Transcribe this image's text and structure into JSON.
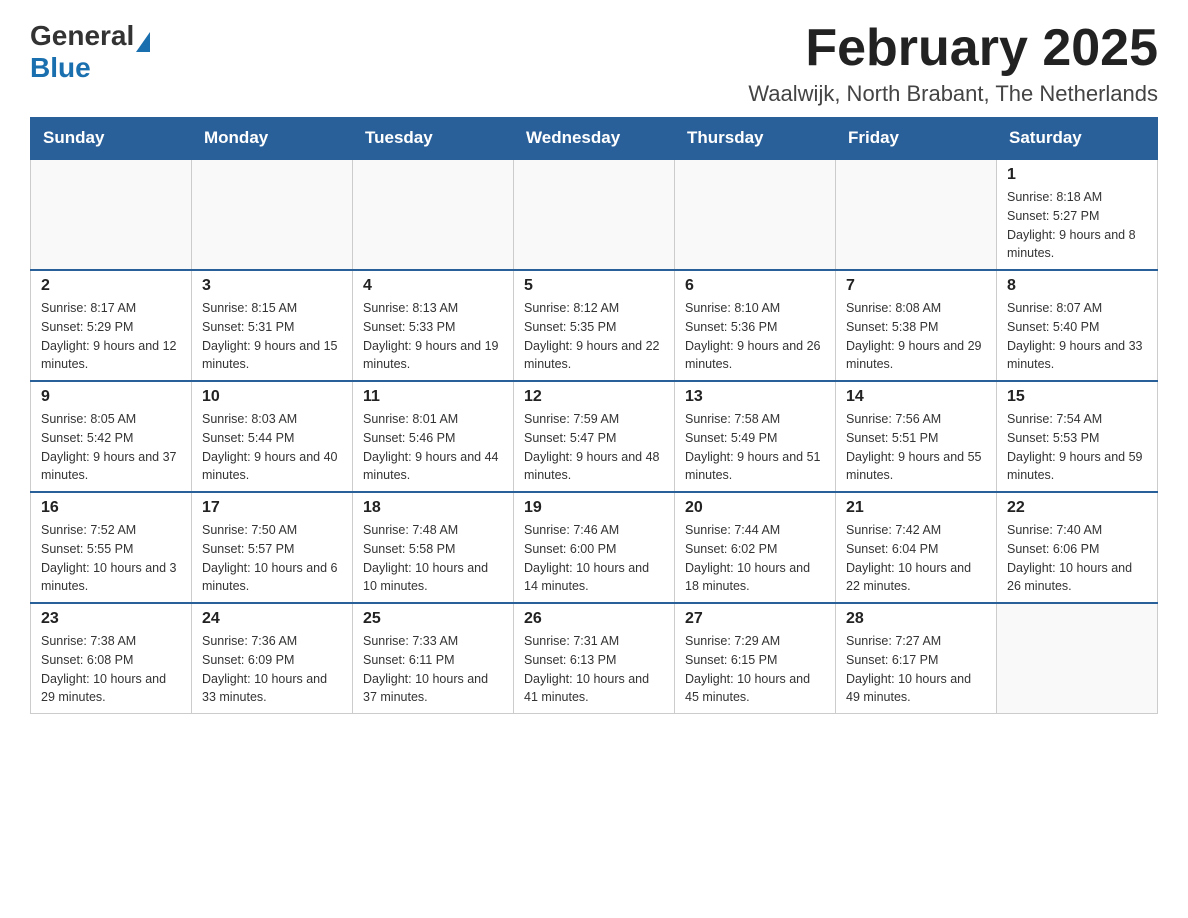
{
  "header": {
    "logo_general": "General",
    "logo_blue": "Blue",
    "title": "February 2025",
    "location": "Waalwijk, North Brabant, The Netherlands"
  },
  "days_of_week": [
    "Sunday",
    "Monday",
    "Tuesday",
    "Wednesday",
    "Thursday",
    "Friday",
    "Saturday"
  ],
  "weeks": [
    {
      "days": [
        {
          "number": "",
          "info": ""
        },
        {
          "number": "",
          "info": ""
        },
        {
          "number": "",
          "info": ""
        },
        {
          "number": "",
          "info": ""
        },
        {
          "number": "",
          "info": ""
        },
        {
          "number": "",
          "info": ""
        },
        {
          "number": "1",
          "info": "Sunrise: 8:18 AM\nSunset: 5:27 PM\nDaylight: 9 hours and 8 minutes."
        }
      ]
    },
    {
      "days": [
        {
          "number": "2",
          "info": "Sunrise: 8:17 AM\nSunset: 5:29 PM\nDaylight: 9 hours and 12 minutes."
        },
        {
          "number": "3",
          "info": "Sunrise: 8:15 AM\nSunset: 5:31 PM\nDaylight: 9 hours and 15 minutes."
        },
        {
          "number": "4",
          "info": "Sunrise: 8:13 AM\nSunset: 5:33 PM\nDaylight: 9 hours and 19 minutes."
        },
        {
          "number": "5",
          "info": "Sunrise: 8:12 AM\nSunset: 5:35 PM\nDaylight: 9 hours and 22 minutes."
        },
        {
          "number": "6",
          "info": "Sunrise: 8:10 AM\nSunset: 5:36 PM\nDaylight: 9 hours and 26 minutes."
        },
        {
          "number": "7",
          "info": "Sunrise: 8:08 AM\nSunset: 5:38 PM\nDaylight: 9 hours and 29 minutes."
        },
        {
          "number": "8",
          "info": "Sunrise: 8:07 AM\nSunset: 5:40 PM\nDaylight: 9 hours and 33 minutes."
        }
      ]
    },
    {
      "days": [
        {
          "number": "9",
          "info": "Sunrise: 8:05 AM\nSunset: 5:42 PM\nDaylight: 9 hours and 37 minutes."
        },
        {
          "number": "10",
          "info": "Sunrise: 8:03 AM\nSunset: 5:44 PM\nDaylight: 9 hours and 40 minutes."
        },
        {
          "number": "11",
          "info": "Sunrise: 8:01 AM\nSunset: 5:46 PM\nDaylight: 9 hours and 44 minutes."
        },
        {
          "number": "12",
          "info": "Sunrise: 7:59 AM\nSunset: 5:47 PM\nDaylight: 9 hours and 48 minutes."
        },
        {
          "number": "13",
          "info": "Sunrise: 7:58 AM\nSunset: 5:49 PM\nDaylight: 9 hours and 51 minutes."
        },
        {
          "number": "14",
          "info": "Sunrise: 7:56 AM\nSunset: 5:51 PM\nDaylight: 9 hours and 55 minutes."
        },
        {
          "number": "15",
          "info": "Sunrise: 7:54 AM\nSunset: 5:53 PM\nDaylight: 9 hours and 59 minutes."
        }
      ]
    },
    {
      "days": [
        {
          "number": "16",
          "info": "Sunrise: 7:52 AM\nSunset: 5:55 PM\nDaylight: 10 hours and 3 minutes."
        },
        {
          "number": "17",
          "info": "Sunrise: 7:50 AM\nSunset: 5:57 PM\nDaylight: 10 hours and 6 minutes."
        },
        {
          "number": "18",
          "info": "Sunrise: 7:48 AM\nSunset: 5:58 PM\nDaylight: 10 hours and 10 minutes."
        },
        {
          "number": "19",
          "info": "Sunrise: 7:46 AM\nSunset: 6:00 PM\nDaylight: 10 hours and 14 minutes."
        },
        {
          "number": "20",
          "info": "Sunrise: 7:44 AM\nSunset: 6:02 PM\nDaylight: 10 hours and 18 minutes."
        },
        {
          "number": "21",
          "info": "Sunrise: 7:42 AM\nSunset: 6:04 PM\nDaylight: 10 hours and 22 minutes."
        },
        {
          "number": "22",
          "info": "Sunrise: 7:40 AM\nSunset: 6:06 PM\nDaylight: 10 hours and 26 minutes."
        }
      ]
    },
    {
      "days": [
        {
          "number": "23",
          "info": "Sunrise: 7:38 AM\nSunset: 6:08 PM\nDaylight: 10 hours and 29 minutes."
        },
        {
          "number": "24",
          "info": "Sunrise: 7:36 AM\nSunset: 6:09 PM\nDaylight: 10 hours and 33 minutes."
        },
        {
          "number": "25",
          "info": "Sunrise: 7:33 AM\nSunset: 6:11 PM\nDaylight: 10 hours and 37 minutes."
        },
        {
          "number": "26",
          "info": "Sunrise: 7:31 AM\nSunset: 6:13 PM\nDaylight: 10 hours and 41 minutes."
        },
        {
          "number": "27",
          "info": "Sunrise: 7:29 AM\nSunset: 6:15 PM\nDaylight: 10 hours and 45 minutes."
        },
        {
          "number": "28",
          "info": "Sunrise: 7:27 AM\nSunset: 6:17 PM\nDaylight: 10 hours and 49 minutes."
        },
        {
          "number": "",
          "info": ""
        }
      ]
    }
  ]
}
